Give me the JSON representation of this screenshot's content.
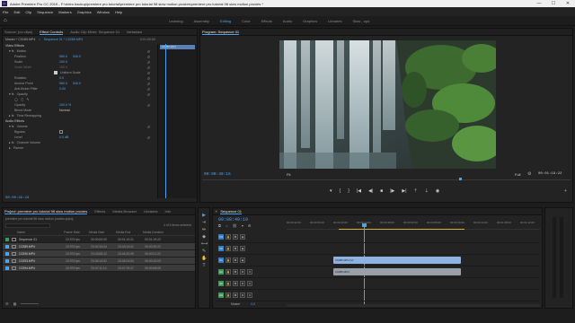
{
  "titlebar": {
    "app_icon": "premiere-pro-logo",
    "title": "Adobe Premiere Pro CC 2019 - F:\\video backup\\premiere pro tutorial\\premiere pro tutorial 98 slow motion proxies\\premiere pro tutorial 98 slow motion proxies *",
    "min": "—",
    "max": "☐",
    "close": "✕"
  },
  "menu": [
    "File",
    "Edit",
    "Clip",
    "Sequence",
    "Markers",
    "Graphics",
    "Window",
    "Help"
  ],
  "workspaces": {
    "home_icon": "home-icon",
    "tabs": [
      "Learning",
      "Assembly",
      "Editing",
      "Color",
      "Effects",
      "Audio",
      "Graphics",
      "Libraries",
      "Slow - opd"
    ],
    "active": "Editing"
  },
  "effect_controls": {
    "tabs": [
      "Source: (no clips)",
      "Effect Controls",
      "Audio Clip Mixer: Sequence 01",
      "Metadata"
    ],
    "active_tab": "Effect Controls",
    "master": "Master * C0289.MP4",
    "seq": "Sequence 01 * C0289.MP4",
    "mini_time": "0:01:00:00",
    "mini_clip": "C0289.MP4",
    "video_effects": "Video Effects",
    "motion": "Motion",
    "position": {
      "label": "Position",
      "x": "960.0",
      "y": "540.0"
    },
    "scale": {
      "label": "Scale",
      "v": "100.0"
    },
    "scale_width": {
      "label": "Scale Width",
      "v": "100.0"
    },
    "uniform": "Uniform Scale",
    "rotation": {
      "label": "Rotation",
      "v": "0.0"
    },
    "anchor": {
      "label": "Anchor Point",
      "x": "960.0",
      "y": "540.0"
    },
    "antiflicker": {
      "label": "Anti-flicker Filter",
      "v": "0.00"
    },
    "opacity": "Opacity",
    "opacity_val": {
      "label": "Opacity",
      "v": "100.0 %"
    },
    "blend": {
      "label": "Blend Mode",
      "v": "Normal"
    },
    "time_remap": "Time Remapping",
    "audio_effects": "Audio Effects",
    "volume": "Volume",
    "bypass": "Bypass",
    "level": {
      "label": "Level",
      "v": "0.0 dB"
    },
    "channel_volume": "Channel Volume",
    "panner": "Panner",
    "timecode": "00:00:49:19"
  },
  "program": {
    "title": "Program: Sequence 01",
    "timecode": "00:00:49:16",
    "fit": "Fit",
    "full": "Full",
    "duration": "00:01:19:22",
    "controls": [
      "marker-icon",
      "in-point-icon",
      "out-point-icon",
      "goto-in-icon",
      "step-back-icon",
      "play-icon",
      "step-forward-icon",
      "goto-out-icon",
      "lift-icon",
      "extract-icon",
      "export-frame-icon",
      "settings-icon",
      "add-button-icon"
    ]
  },
  "project": {
    "tabs": [
      "Project: premiere pro tutorial 98 slow motion proxies",
      "Effects",
      "Media Browser",
      "Libraries",
      "Info"
    ],
    "path": "premiere pro tutorial 98 slow motion proxies.prproj",
    "search_placeholder": "",
    "selected_count": "4 of 5 items selected",
    "columns": [
      "Name",
      "Frame Rate",
      "Media Start",
      "Media End",
      "Media Duration"
    ],
    "rows": [
      {
        "name": "Sequence 01",
        "fr": "23.976 fps",
        "start": "00:00:00:00",
        "end": "00:01:19:21",
        "dur": "00:01:19:22",
        "color": "#3a9a5a",
        "sel": false
      },
      {
        "name": "C0289.MP4",
        "fr": "23.976 fps",
        "start": "23:42:34:04",
        "end": "23:43:14:01",
        "dur": "00:00:39:22",
        "color": "#4aa3f0",
        "sel": true
      },
      {
        "name": "C0290.MP4",
        "fr": "23.976 fps",
        "start": "23:43:58:12",
        "end": "23:44:20:09",
        "dur": "00:00:21:22",
        "color": "#4aa3f0",
        "sel": true
      },
      {
        "name": "C0293.MP4",
        "fr": "23.976 fps",
        "start": "23:45:14:01",
        "end": "23:45:24:03",
        "dur": "00:00:10:03",
        "color": "#4aa3f0",
        "sel": true
      },
      {
        "name": "C0294.MP4",
        "fr": "23.976 fps",
        "start": "23:47:11:13",
        "end": "23:47:19:17",
        "dur": "00:00:08:05",
        "color": "#4aa3f0",
        "sel": true
      }
    ]
  },
  "timeline": {
    "tab": "Sequence 01",
    "timecode": "00:00:49:19",
    "ruler": [
      "00:00:32:00",
      "00:00:36:00",
      "00:00:40:00",
      "00:00:44:00",
      "00:00:48:00",
      "00:00:52:00",
      "00:00:56:00",
      "00:01:00:00",
      "00:01:04:00",
      "00:01:08:00",
      "00:01:12:00"
    ],
    "video_tracks": [
      "V3",
      "V2",
      "V1"
    ],
    "audio_tracks": [
      "A1",
      "A2",
      "A3"
    ],
    "master": "Master",
    "master_val": "0.0",
    "clips": [
      {
        "name": "C0289.MP4 [V]",
        "color": "#8fb3e0"
      },
      {
        "name": "C0289.MP4",
        "color": "#9aa0a8"
      }
    ]
  },
  "tools": [
    "selection-tool-icon",
    "track-select-icon",
    "ripple-edit-icon",
    "razor-icon",
    "slip-icon",
    "pen-icon",
    "hand-icon",
    "type-icon"
  ]
}
